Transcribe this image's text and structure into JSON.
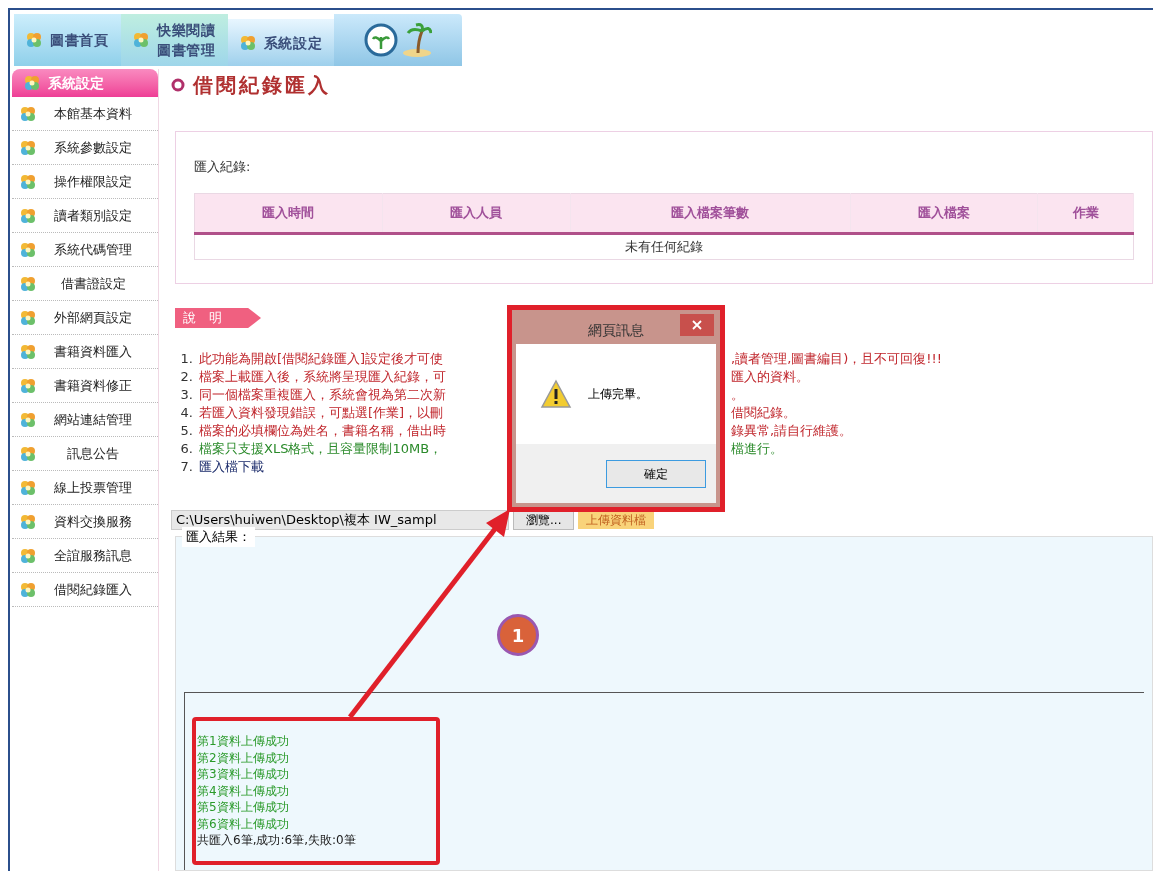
{
  "top_nav": [
    {
      "labels": [
        "圖書首頁"
      ],
      "selected": false
    },
    {
      "labels": [
        "快樂閱讀",
        "圖書管理"
      ],
      "selected": false
    },
    {
      "labels": [
        "系統設定"
      ],
      "selected": true
    }
  ],
  "sidebar": {
    "title": "系統設定",
    "items": [
      "本館基本資料",
      "系統參數設定",
      "操作權限設定",
      "讀者類別設定",
      "系統代碼管理",
      "借書證設定",
      "外部網頁設定",
      "書籍資料匯入",
      "書籍資料修正",
      "網站連結管理",
      "訊息公告",
      "線上投票管理",
      "資料交換服務",
      "全誼服務訊息",
      "借閱紀錄匯入"
    ]
  },
  "page_title": "借閱紀錄匯入",
  "records": {
    "label": "匯入紀錄:",
    "columns": [
      "匯入時間",
      "匯入人員",
      "匯入檔案筆數",
      "匯入檔案",
      "作業"
    ],
    "empty_message": "未有任何紀錄"
  },
  "notes": {
    "badge": "說　明",
    "items": [
      {
        "number": "1.",
        "kind": "warning",
        "left": "此功能為開啟[借閱紀錄匯入]設定後才可使",
        "right": ",讀者管理,圖書編目)，且不可回復!!!"
      },
      {
        "number": "2.",
        "kind": "warning",
        "left": "檔案上載匯入後，系統將呈現匯入紀錄，可",
        "right": "匯入的資料。"
      },
      {
        "number": "3.",
        "kind": "warning",
        "left": "同一個檔案重複匯入，系統會視為第二次新",
        "right": "。"
      },
      {
        "number": "4.",
        "kind": "warning",
        "left": "若匯入資料發現錯誤，可點選[作業]，以刪",
        "right": "借閱紀錄。"
      },
      {
        "number": "5.",
        "kind": "warning",
        "left": "檔案的必填欄位為姓名，書籍名稱，借出時",
        "right": "錄異常,請自行維護。"
      },
      {
        "number": "6.",
        "kind": "info",
        "left": "檔案只支援XLS格式，且容量限制10MB，",
        "right": "檔進行。"
      },
      {
        "number": "7.",
        "kind": "link",
        "left": "匯入檔下載"
      }
    ]
  },
  "upload": {
    "value": "C:\\Users\\huiwen\\Desktop\\複本 IW_sampl",
    "browse_button": "瀏覽...",
    "upload_button": "上傳資料檔"
  },
  "results": {
    "label": "匯入結果：",
    "lines": [
      {
        "text": "第1資料上傳成功",
        "kind": "success"
      },
      {
        "text": "第2資料上傳成功",
        "kind": "success"
      },
      {
        "text": "第3資料上傳成功",
        "kind": "success"
      },
      {
        "text": "第4資料上傳成功",
        "kind": "success"
      },
      {
        "text": "第5資料上傳成功",
        "kind": "success"
      },
      {
        "text": "第6資料上傳成功",
        "kind": "success"
      },
      {
        "text": "共匯入6筆,成功:6筆,失敗:0筆",
        "kind": "summary"
      }
    ]
  },
  "dialog": {
    "title": "網頁訊息",
    "message": "上傳完畢。",
    "ok_button": "確定"
  },
  "callout": {
    "number": "1"
  }
}
